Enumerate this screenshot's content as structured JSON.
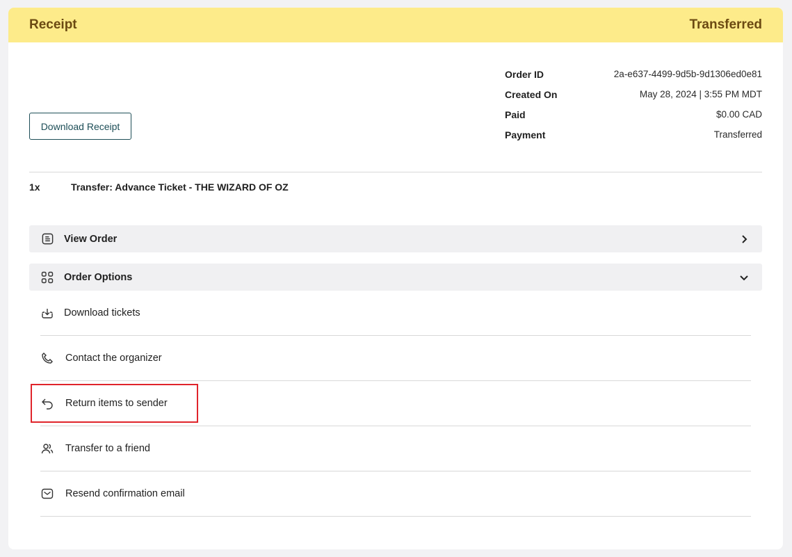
{
  "header": {
    "title": "Receipt",
    "status": "Transferred",
    "bg_color": "#fdeb8a",
    "text_color": "#6b4a12"
  },
  "download_receipt_label": "Download Receipt",
  "order_meta": [
    {
      "key": "Order ID",
      "value": "2a-e637-4499-9d5b-9d1306ed0e81"
    },
    {
      "key": "Created On",
      "value": "May 28, 2024 | 3:55 PM MDT"
    },
    {
      "key": "Paid",
      "value": "$0.00 CAD"
    },
    {
      "key": "Payment",
      "value": "Transferred"
    }
  ],
  "line_item": {
    "qty": "1x",
    "name": "Transfer: Advance Ticket - THE WIZARD OF OZ"
  },
  "view_order": {
    "label": "View Order",
    "icon": "document-list-icon",
    "chevron": "chevron-right-icon"
  },
  "order_options": {
    "label": "Order Options",
    "icon": "grid-icon",
    "chevron": "chevron-down-icon"
  },
  "options": [
    {
      "label": "Download tickets",
      "icon": "download-icon"
    },
    {
      "label": "Contact the organizer",
      "icon": "phone-icon"
    },
    {
      "label": "Return items to sender",
      "icon": "return-arrow-icon",
      "highlighted": true
    },
    {
      "label": "Transfer to a friend",
      "icon": "users-icon"
    },
    {
      "label": "Resend confirmation email",
      "icon": "mail-icon"
    }
  ],
  "highlight_color": "#e0242b"
}
